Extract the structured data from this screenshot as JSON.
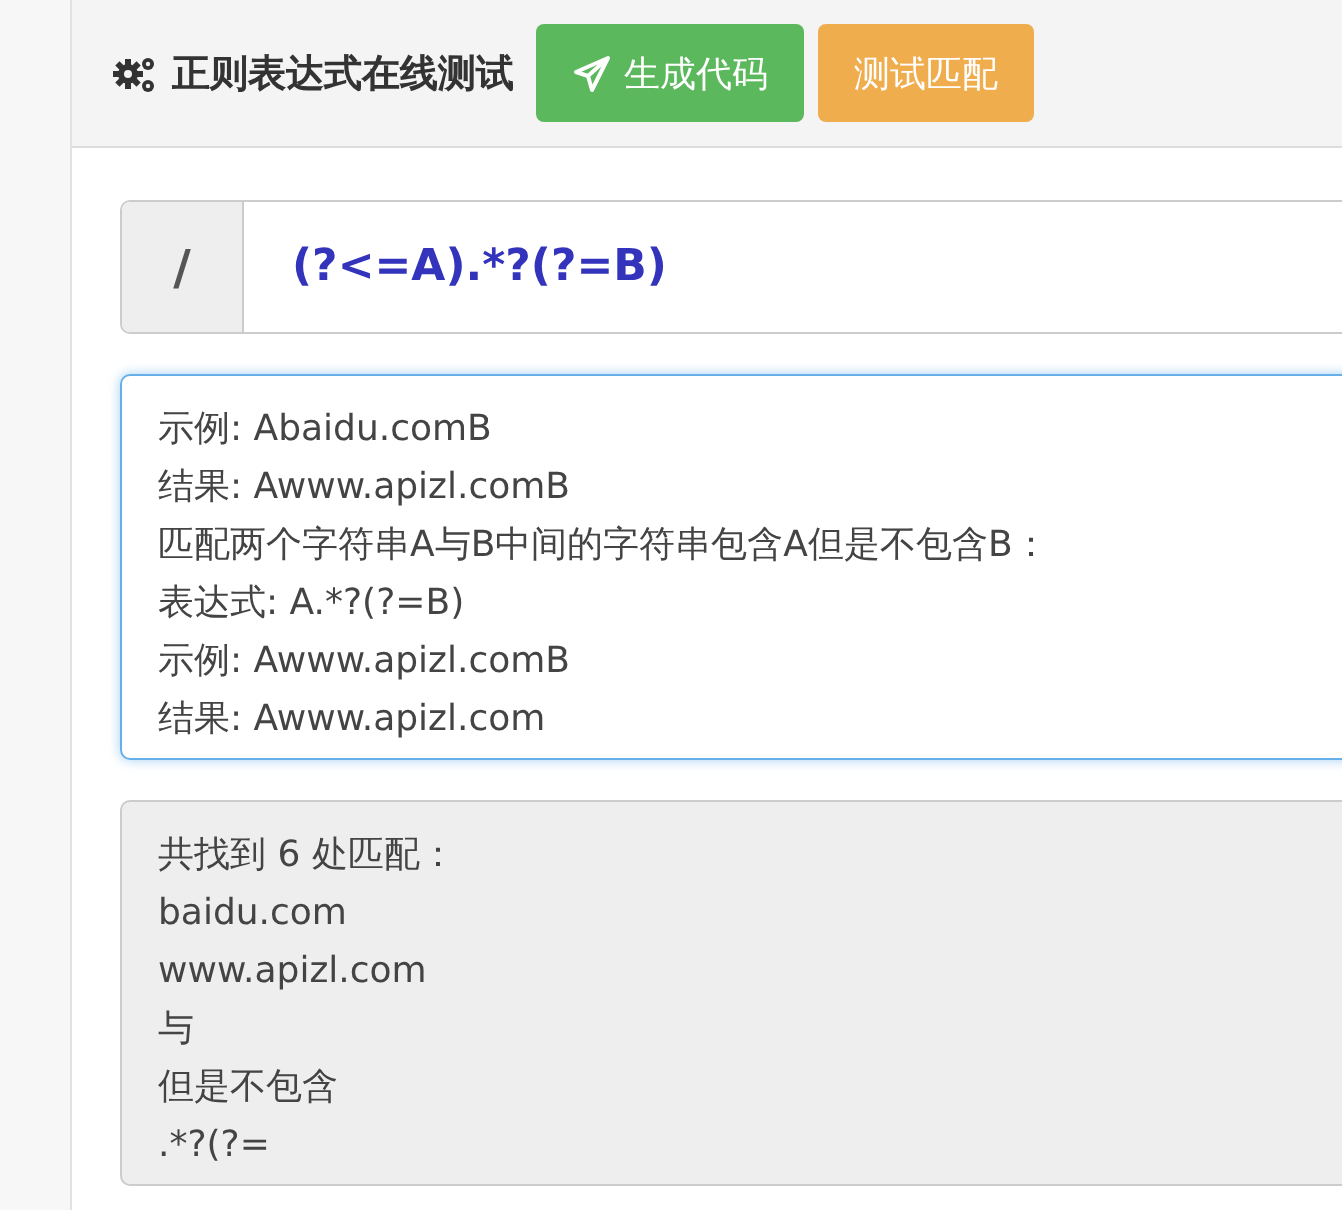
{
  "header": {
    "title": "正则表达式在线测试",
    "buttons": [
      {
        "label": "生成代码",
        "kind": "success"
      },
      {
        "label": "测试匹配",
        "kind": "warning"
      }
    ]
  },
  "regex": {
    "prefix": "/",
    "value": "(?<=A).*?(?=B)"
  },
  "text_input": {
    "lines": [
      "示例: Abaidu.comB",
      "结果: Awww.apizl.comB",
      "匹配两个字符串A与B中间的字符串包含A但是不包含B：",
      "表达式: A.*?(?=B)",
      "示例: Awww.apizl.comB",
      "结果: Awww.apizl.com"
    ]
  },
  "result": {
    "lines": [
      "共找到 6 处匹配：",
      "baidu.com",
      "www.apizl.com",
      "与",
      "但是不包含",
      ".*?(?="
    ]
  }
}
